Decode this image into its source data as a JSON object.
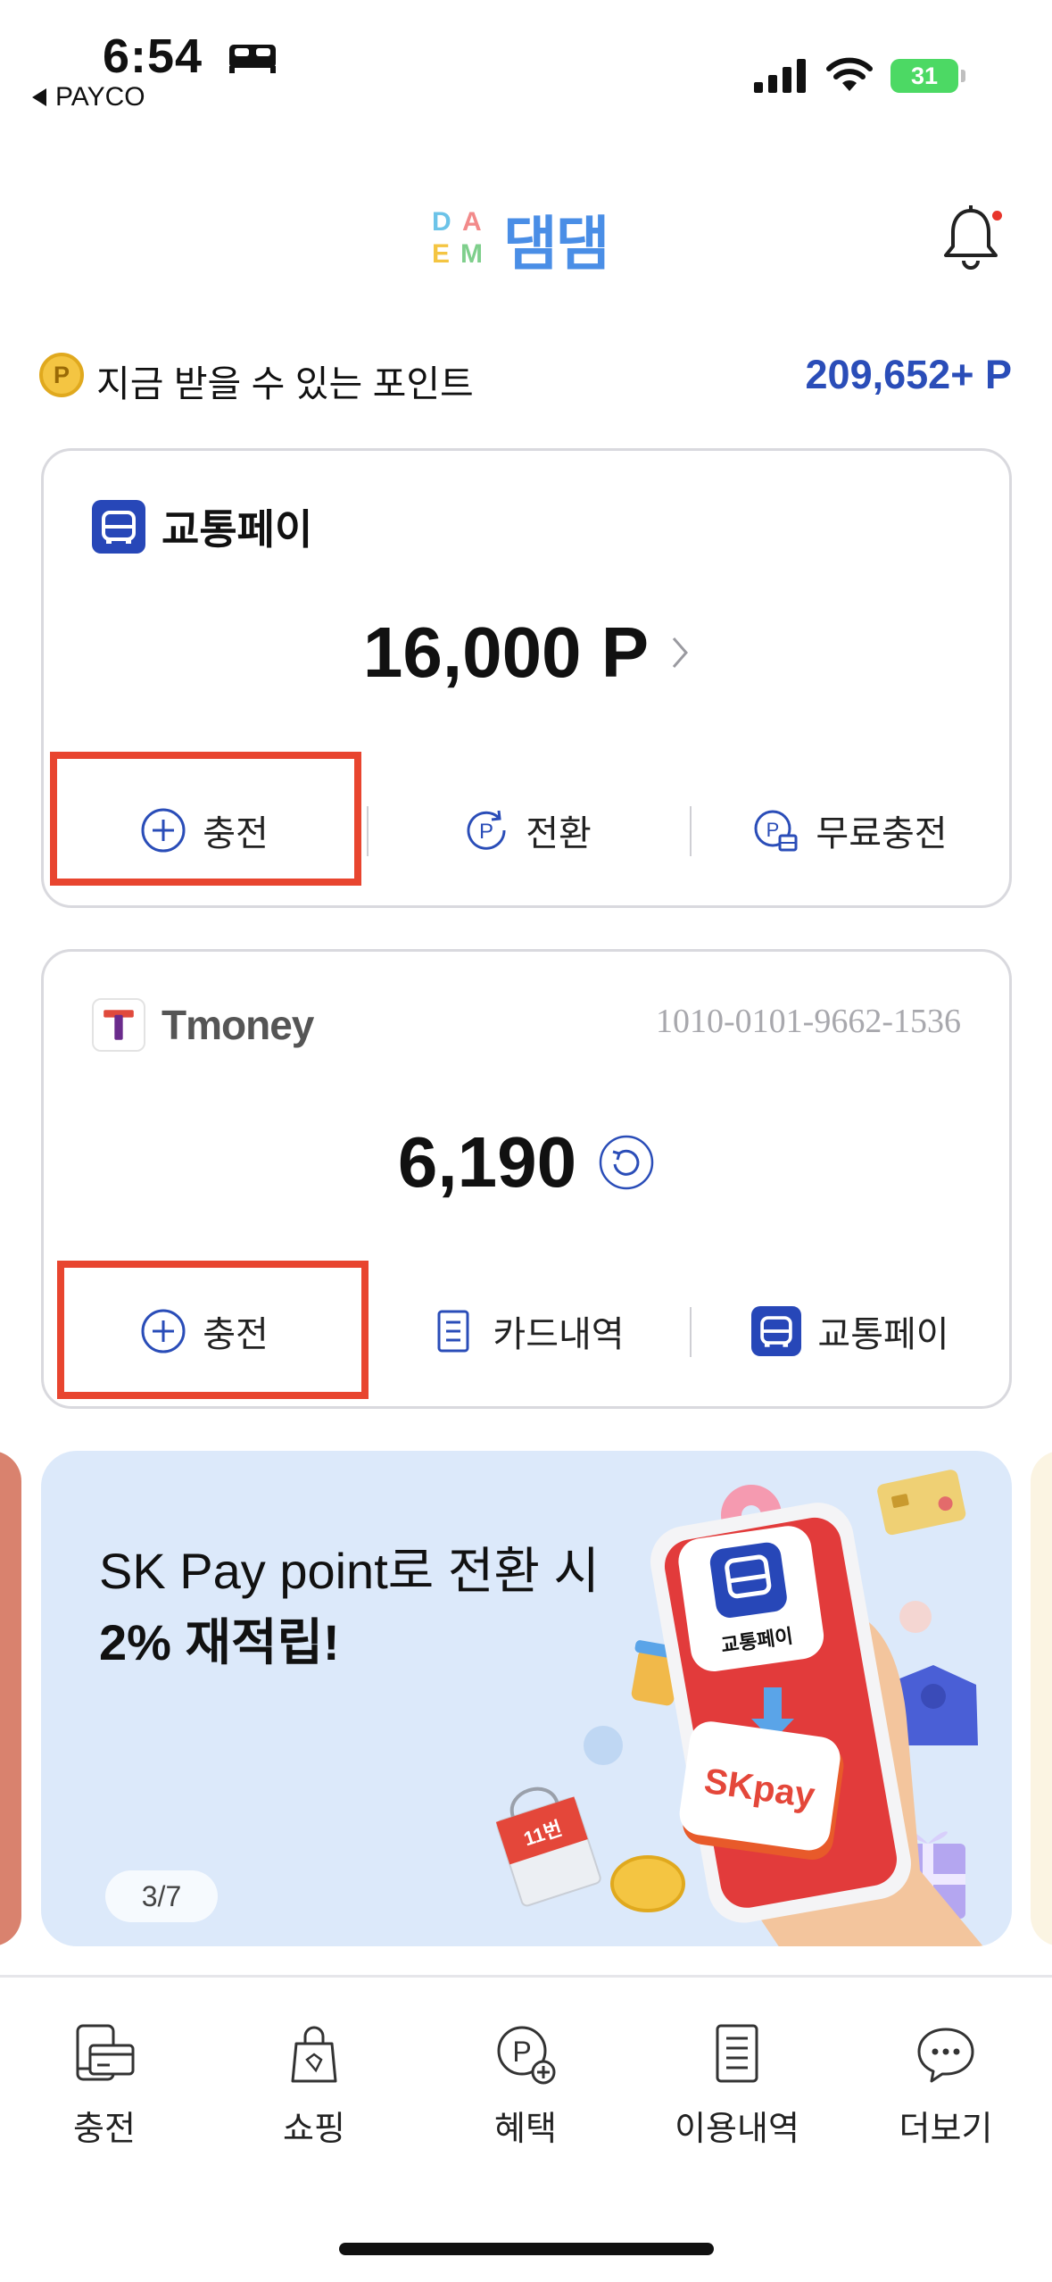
{
  "status_bar": {
    "time": "6:54",
    "back_app": "PAYCO",
    "battery": "31"
  },
  "header": {
    "logo_text": "댐댐",
    "logo_letters": [
      "D",
      "A",
      "E",
      "M"
    ],
    "notification_dot": true
  },
  "points": {
    "label": "지금 받을 수 있는 포인트",
    "value": "209,652+ P",
    "coin_letter": "P"
  },
  "transit_pay_card": {
    "title": "교통페이",
    "balance": "16,000 P",
    "actions": [
      {
        "label": "충전",
        "icon": "plus-circle-icon"
      },
      {
        "label": "전환",
        "icon": "point-convert-icon"
      },
      {
        "label": "무료충전",
        "icon": "point-free-icon"
      }
    ]
  },
  "tmoney_card": {
    "title": "Tmoney",
    "card_number": "1010-0101-9662-1536",
    "balance": "6,190",
    "actions": [
      {
        "label": "충전",
        "icon": "plus-circle-icon"
      },
      {
        "label": "카드내역",
        "icon": "document-icon"
      },
      {
        "label": "교통페이",
        "icon": "bus-icon"
      }
    ]
  },
  "banner": {
    "line1": "SK Pay point로 전환 시",
    "line2": "2% 재적립!",
    "page_indicator": "3/7",
    "art_badge_label": "교통페이",
    "art_skpay": "SKpay",
    "art_bag": "11번"
  },
  "bottom_nav": [
    {
      "label": "충전",
      "icon": "charge-device-icon"
    },
    {
      "label": "쇼핑",
      "icon": "shopping-bag-icon"
    },
    {
      "label": "혜택",
      "icon": "benefit-point-icon"
    },
    {
      "label": "이용내역",
      "icon": "history-list-icon"
    },
    {
      "label": "더보기",
      "icon": "more-chat-icon"
    }
  ],
  "colors": {
    "accent_blue": "#2a4db8",
    "brand_bus": "#2747b8",
    "highlight_red": "#e8452f",
    "banner_bg": "#dce9fa",
    "battery_green": "#4cd964"
  }
}
